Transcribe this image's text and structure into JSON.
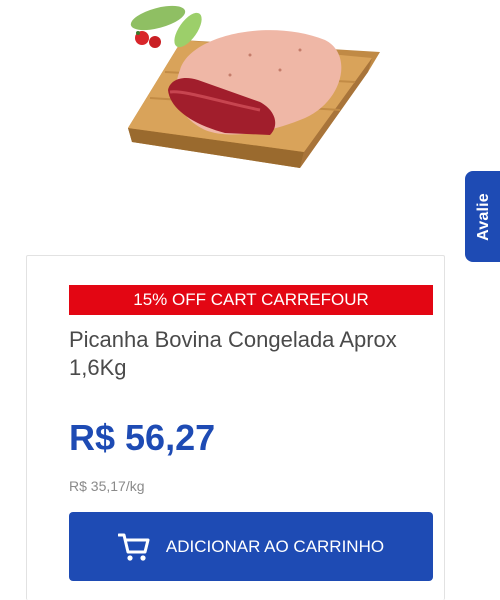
{
  "avalie_tab": {
    "label": "Avalie"
  },
  "product": {
    "promo_banner": "15% OFF CART CARREFOUR",
    "title": "Picanha Bovina Congelada Aprox 1,6Kg",
    "price": "R$ 56,27",
    "unit_price": "R$ 35,17/kg",
    "add_to_cart_label": "ADICIONAR AO CARRINHO",
    "image_icon": "meat-on-cutting-board-image"
  },
  "colors": {
    "brand_blue": "#1e4bb4",
    "promo_red": "#e30613",
    "title_gray": "#4a4a4a",
    "unit_price_gray": "#8a8a8a"
  }
}
